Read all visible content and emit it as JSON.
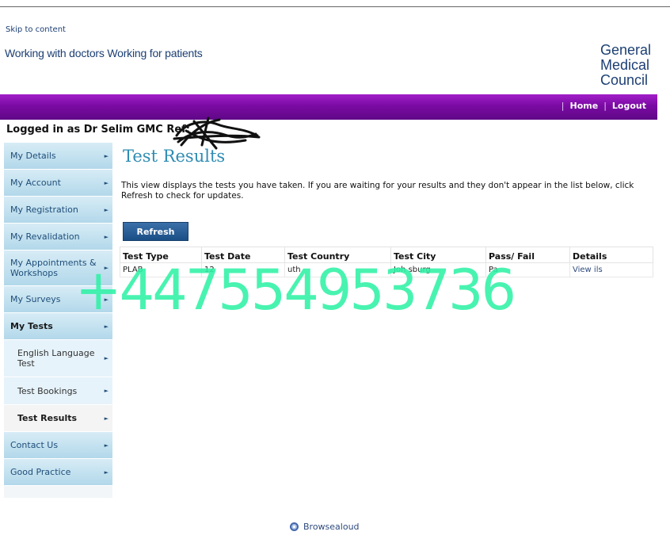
{
  "header": {
    "skip_link": "Skip to content",
    "tagline": "Working with doctors Working for patients",
    "logo_lines": [
      "General",
      "Medical",
      "Council"
    ]
  },
  "topnav": {
    "home": "Home",
    "logout": "Logout",
    "separator": "|"
  },
  "user": {
    "logged_in_text": "Logged in as Dr Selim GMC Ref:"
  },
  "sidebar": {
    "items": [
      {
        "label": "My Details"
      },
      {
        "label": "My Account"
      },
      {
        "label": "My Registration"
      },
      {
        "label": "My Revalidation"
      },
      {
        "label": "My Appointments & Workshops"
      },
      {
        "label": "My Surveys"
      },
      {
        "label": "My Tests"
      },
      {
        "label": "English Language Test"
      },
      {
        "label": "Test Bookings"
      },
      {
        "label": "Test Results"
      },
      {
        "label": "Contact Us"
      },
      {
        "label": "Good Practice"
      }
    ],
    "arrow": "►"
  },
  "main": {
    "title": "Test Results",
    "description": "This view displays the tests you have taken. If you are waiting for your results and they don't appear in the list below, click Refresh to check for updates.",
    "refresh_button": "Refresh",
    "table": {
      "headers": [
        "Test Type",
        "Test Date",
        "Test Country",
        "Test City",
        "Pass/ Fail",
        "Details"
      ],
      "rows": [
        [
          "PLAB",
          "12",
          "uth",
          "Joh    sburg",
          "Pa",
          "View    ils"
        ]
      ]
    }
  },
  "overlay": {
    "watermark": "+447554953736"
  },
  "footer": {
    "label": "Browsealoud"
  }
}
